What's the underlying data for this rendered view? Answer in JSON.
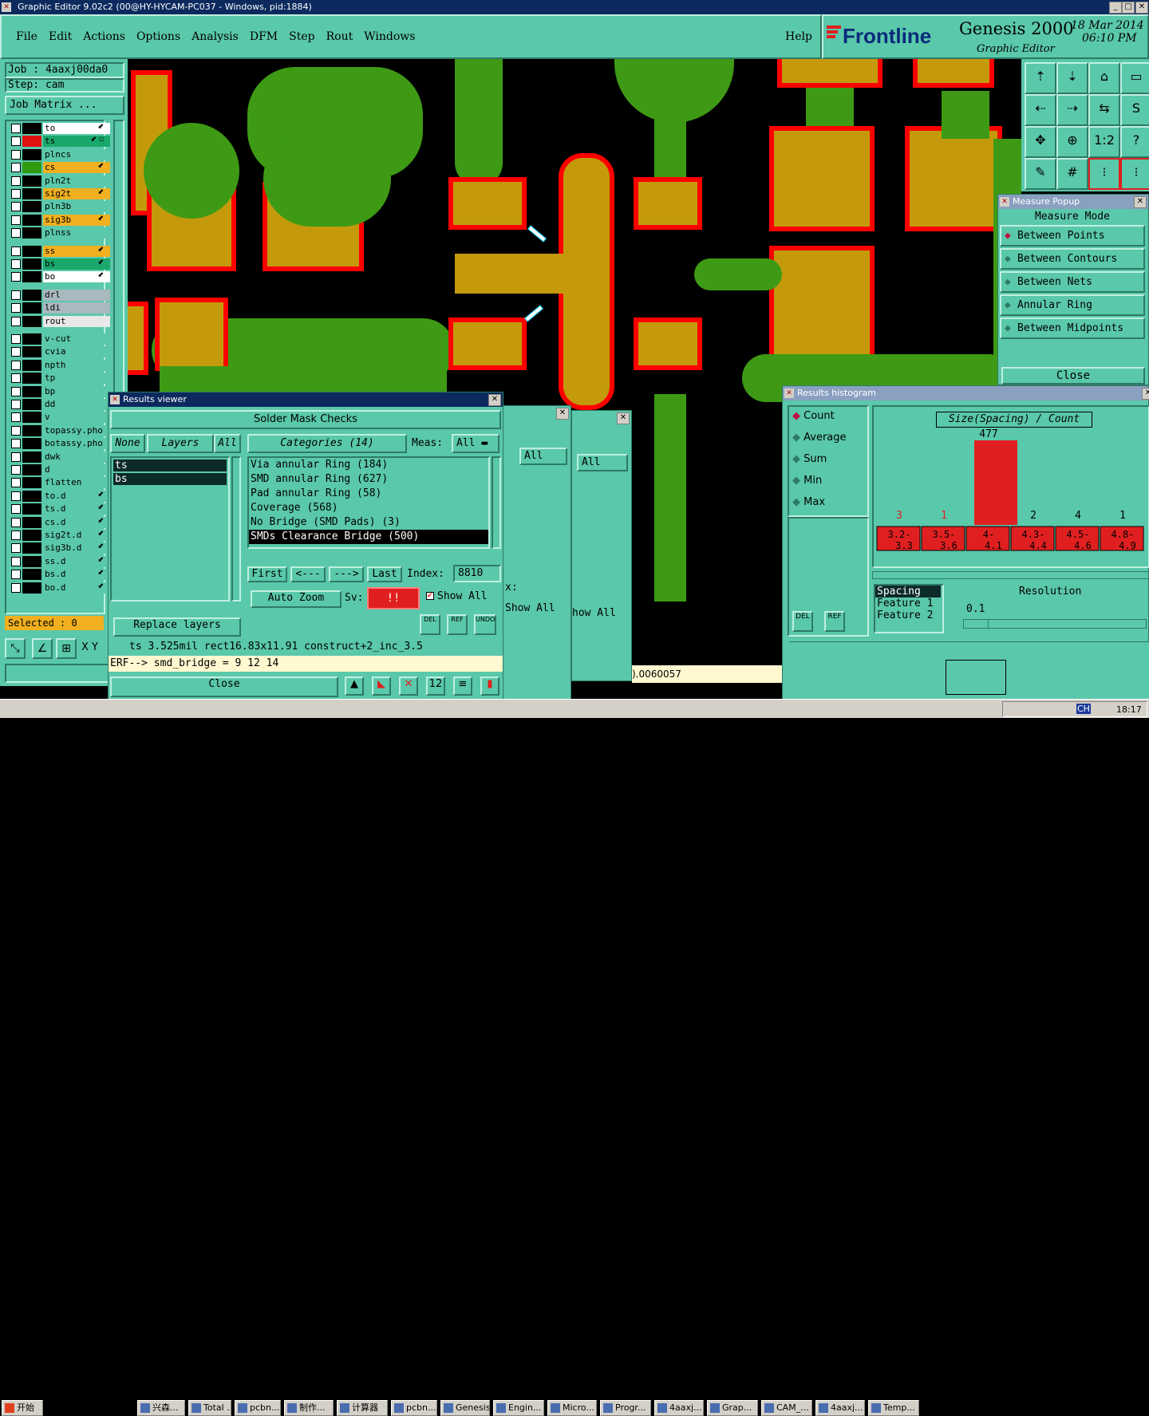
{
  "window_title": "Graphic Editor 9.02c2 (00@HY-HYCAM-PC037 - Windows, pid:1884)",
  "menu": [
    "File",
    "Edit",
    "Actions",
    "Options",
    "Analysis",
    "DFM",
    "Step",
    "Rout",
    "Windows"
  ],
  "help": "Help",
  "brand": {
    "logo": "Frontline",
    "product": "Genesis 2000",
    "sub": "Graphic Editor",
    "date": "18 Mar 2014",
    "time": "06:10 PM"
  },
  "job": {
    "job": "Job : 4aaxj00da0",
    "step": "Step: cam",
    "matrix": "Job Matrix ..."
  },
  "layers": [
    {
      "name": "to",
      "color": "#ffffff",
      "sw": "#000000",
      "mk": "⬋"
    },
    {
      "name": "ts",
      "color": "#1aa86c",
      "sw": "#e01010",
      "mk": "⬋ ▫"
    },
    {
      "name": "plncs",
      "color": "#5ac8aa",
      "sw": "#000000",
      "mk": ""
    },
    {
      "name": "cs",
      "color": "#f0b020",
      "sw": "#2f9a10",
      "mk": "⬋"
    },
    {
      "name": "pln2t",
      "color": "#5ac8aa",
      "sw": "#000000",
      "mk": ""
    },
    {
      "name": "sig2t",
      "color": "#f0b020",
      "sw": "#000000",
      "mk": "⬋"
    },
    {
      "name": "pln3b",
      "color": "#5ac8aa",
      "sw": "#000000",
      "mk": ""
    },
    {
      "name": "sig3b",
      "color": "#f0b020",
      "sw": "#000000",
      "mk": "⬋"
    },
    {
      "name": "plnss",
      "color": "#5ac8aa",
      "sw": "#000000",
      "mk": ""
    },
    {
      "name": "ss",
      "color": "#f0b020",
      "sw": "#000000",
      "mk": "⬋"
    },
    {
      "name": "bs",
      "color": "#1aa86c",
      "sw": "#000000",
      "mk": "⬋"
    },
    {
      "name": "bo",
      "color": "#ffffff",
      "sw": "#000000",
      "mk": "⬋"
    },
    {
      "name": "drl",
      "color": "#aab8c0",
      "sw": "#000000",
      "mk": ""
    },
    {
      "name": "ldi",
      "color": "#aab8c0",
      "sw": "#000000",
      "mk": ""
    },
    {
      "name": "rout",
      "color": "#e8e8e8",
      "sw": "#000000",
      "mk": ""
    },
    {
      "name": "v-cut",
      "color": "#5ac8aa",
      "sw": "#000000",
      "mk": ""
    },
    {
      "name": "cvia",
      "color": "#5ac8aa",
      "sw": "#000000",
      "mk": ""
    },
    {
      "name": "npth",
      "color": "#5ac8aa",
      "sw": "#000000",
      "mk": ""
    },
    {
      "name": "tp",
      "color": "#5ac8aa",
      "sw": "#000000",
      "mk": ""
    },
    {
      "name": "bp",
      "color": "#5ac8aa",
      "sw": "#000000",
      "mk": ""
    },
    {
      "name": "dd",
      "color": "#5ac8aa",
      "sw": "#000000",
      "mk": ""
    },
    {
      "name": "v",
      "color": "#5ac8aa",
      "sw": "#000000",
      "mk": ""
    },
    {
      "name": "topassy.pho",
      "color": "#5ac8aa",
      "sw": "#000000",
      "mk": ""
    },
    {
      "name": "botassy.pho",
      "color": "#5ac8aa",
      "sw": "#000000",
      "mk": ""
    },
    {
      "name": "dwk",
      "color": "#5ac8aa",
      "sw": "#000000",
      "mk": ""
    },
    {
      "name": "d",
      "color": "#5ac8aa",
      "sw": "#000000",
      "mk": ""
    },
    {
      "name": "flatten",
      "color": "#5ac8aa",
      "sw": "#000000",
      "mk": ""
    },
    {
      "name": "to.d",
      "color": "#5ac8aa",
      "sw": "#000000",
      "mk": "⬋"
    },
    {
      "name": "ts.d",
      "color": "#5ac8aa",
      "sw": "#000000",
      "mk": "⬋"
    },
    {
      "name": "cs.d",
      "color": "#5ac8aa",
      "sw": "#000000",
      "mk": "⬋"
    },
    {
      "name": "sig2t.d",
      "color": "#5ac8aa",
      "sw": "#000000",
      "mk": "⬋"
    },
    {
      "name": "sig3b.d",
      "color": "#5ac8aa",
      "sw": "#000000",
      "mk": "⬋"
    },
    {
      "name": "ss.d",
      "color": "#5ac8aa",
      "sw": "#000000",
      "mk": "⬋"
    },
    {
      "name": "bs.d",
      "color": "#5ac8aa",
      "sw": "#000000",
      "mk": "⬋"
    },
    {
      "name": "bo.d",
      "color": "#5ac8aa",
      "sw": "#000000",
      "mk": "⬋"
    }
  ],
  "selected": "Selected : 0",
  "xy": "X Y",
  "measure": {
    "title": "Measure Popup",
    "mode": "Measure Mode",
    "options": [
      "Between Points",
      "Between Contours",
      "Between Nets",
      "Annular Ring",
      "Between Midpoints"
    ],
    "close": "Close"
  },
  "results": {
    "title": "Results viewer",
    "heading": "Solder Mask Checks",
    "none": "None",
    "layers": "Layers",
    "all": "All",
    "categories": "Categories (14)",
    "meas_label": "Meas:",
    "meas_value": "All",
    "layer_list": [
      "ts",
      "bs"
    ],
    "cat_list": [
      "Via annular Ring (184)",
      "SMD annular Ring (627)",
      "Pad annular Ring (58)",
      "Coverage (568)",
      "No Bridge (SMD Pads) (3)",
      "SMDs Clearance Bridge (500)"
    ],
    "first": "First",
    "prev": "<---",
    "next": "--->",
    "last": "Last",
    "index_label": "Index:",
    "index_value": "8810",
    "auto_zoom": "Auto Zoom",
    "sv": "Sv:",
    "sv_value": "!!",
    "show_all": "Show All",
    "replace_layers": "Replace layers",
    "del": "DEL",
    "ref": "REF",
    "undo": "UNDO",
    "status": "ts 3.525mil   rect16.83x11.91   construct+2_inc_3.5",
    "erf": "ERF--> smd_bridge = 9 12 14",
    "close": "Close"
  },
  "behind": {
    "all1": "All",
    "all2": "All",
    "x_label": "x:",
    "show_all": "Show All",
    "show_all2": "how All",
    "value": ").0060057"
  },
  "histogram": {
    "title": "Results histogram",
    "modes": [
      "Count",
      "Average",
      "Sum",
      "Min",
      "Max"
    ],
    "chart_title": "Size(Spacing) / Count",
    "resolution_label": "Resolution",
    "resolution": "0.1",
    "list": [
      "Spacing",
      "Feature 1",
      "Feature 2"
    ],
    "del": "DEL",
    "ref": "REF"
  },
  "chart_data": {
    "type": "bar",
    "title": "Size(Spacing) / Count",
    "categories": [
      "3.2-3.3",
      "3.5-3.6",
      "4-4.1",
      "4.3-4.4",
      "4.5-4.6",
      "4.8-4.9"
    ],
    "values": [
      3,
      1,
      477,
      2,
      4,
      1
    ],
    "ylim": [
      0,
      477
    ]
  },
  "taskbar": {
    "start": "开始",
    "items": [
      "兴森...",
      "Total ...",
      "pcbn...",
      "制作...",
      "计算器",
      "pcbn...",
      "Genesis",
      "Engin...",
      "Micro...",
      "Progr...",
      "4aaxj...",
      "Grap...",
      "CAM_...",
      "4aaxj...",
      "Temp..."
    ],
    "lang": "CH",
    "clock": "18:17"
  }
}
